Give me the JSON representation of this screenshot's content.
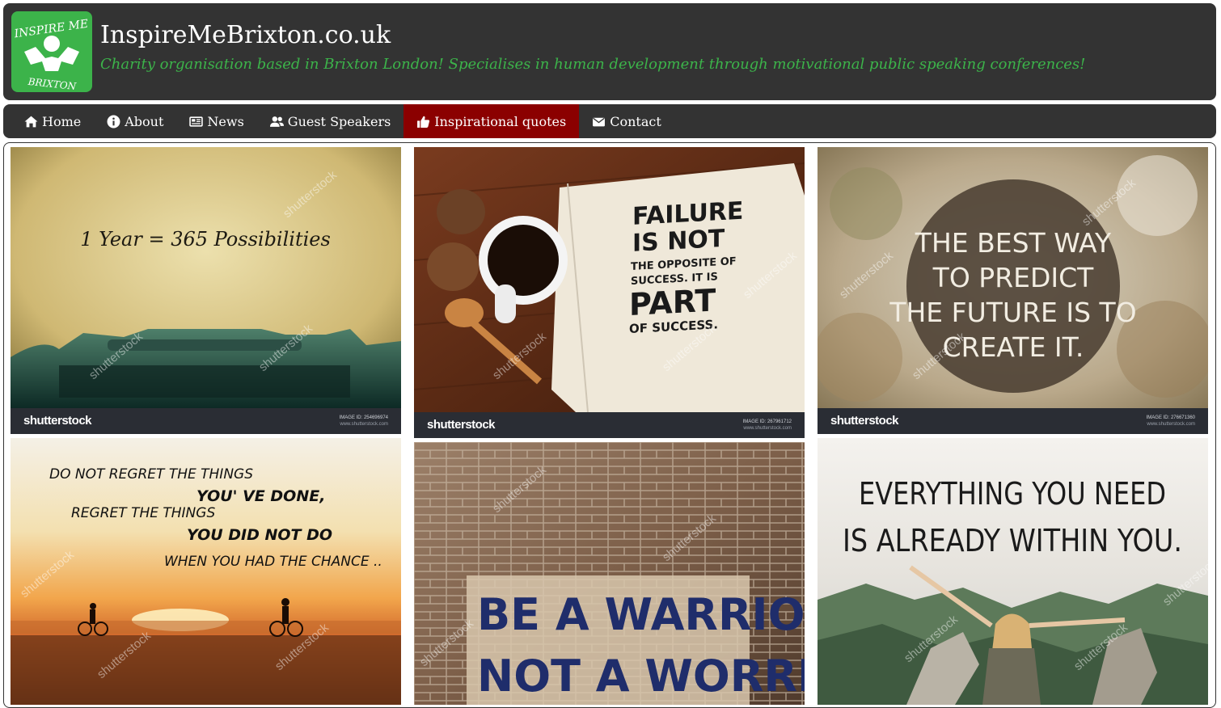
{
  "site": {
    "title": "InspireMeBrixton.co.uk",
    "tagline": "Charity organisation based in Brixton London! Specialises in human development through motivational public speaking conferences!",
    "logo_text_top": "INSPIRE ME",
    "logo_text_bottom": "BRIXTON",
    "colors": {
      "header_bg": "#333333",
      "accent_green": "#3cb34a",
      "active_tab": "#8b0000"
    }
  },
  "nav": {
    "items": [
      {
        "label": "Home",
        "icon": "home-icon"
      },
      {
        "label": "About",
        "icon": "info-circle-icon"
      },
      {
        "label": "News",
        "icon": "newspaper-icon"
      },
      {
        "label": "Guest Speakers",
        "icon": "users-icon"
      },
      {
        "label": "Inspirational quotes",
        "icon": "thumbs-up-icon",
        "active": true
      },
      {
        "label": "Contact",
        "icon": "envelope-icon"
      }
    ]
  },
  "gallery": {
    "watermark": "shutterstock",
    "images": [
      {
        "quote_lines": [
          "1 Year = 365 Possibilities"
        ],
        "brand": "shutterstock",
        "image_id": "IMAGE ID: 254696974",
        "site": "www.shutterstock.com"
      },
      {
        "quote_lines": [
          "FAILURE",
          "IS NOT",
          "THE OPPOSITE OF",
          "SUCCESS. IT IS",
          "PART",
          "OF SUCCESS."
        ],
        "brand": "shutterstock",
        "image_id": "IMAGE ID: 267961712",
        "site": "www.shutterstock.com"
      },
      {
        "quote_lines": [
          "THE BEST WAY",
          "TO PREDICT",
          "THE FUTURE IS TO",
          "CREATE IT."
        ],
        "brand": "shutterstock",
        "image_id": "IMAGE ID: 276671360",
        "site": "www.shutterstock.com"
      },
      {
        "quote_lines": [
          "DO NOT REGRET THE THINGS",
          "YOU' VE DONE,",
          "REGRET THE THINGS",
          "YOU DID NOT DO",
          "WHEN YOU HAD THE CHANCE .."
        ]
      },
      {
        "quote_lines": [
          "BE A WARRIOR,",
          "NOT A WORRIER."
        ]
      },
      {
        "quote_lines": [
          "EVERYTHING YOU NEED",
          "IS ALREADY WITHIN YOU."
        ]
      }
    ]
  }
}
